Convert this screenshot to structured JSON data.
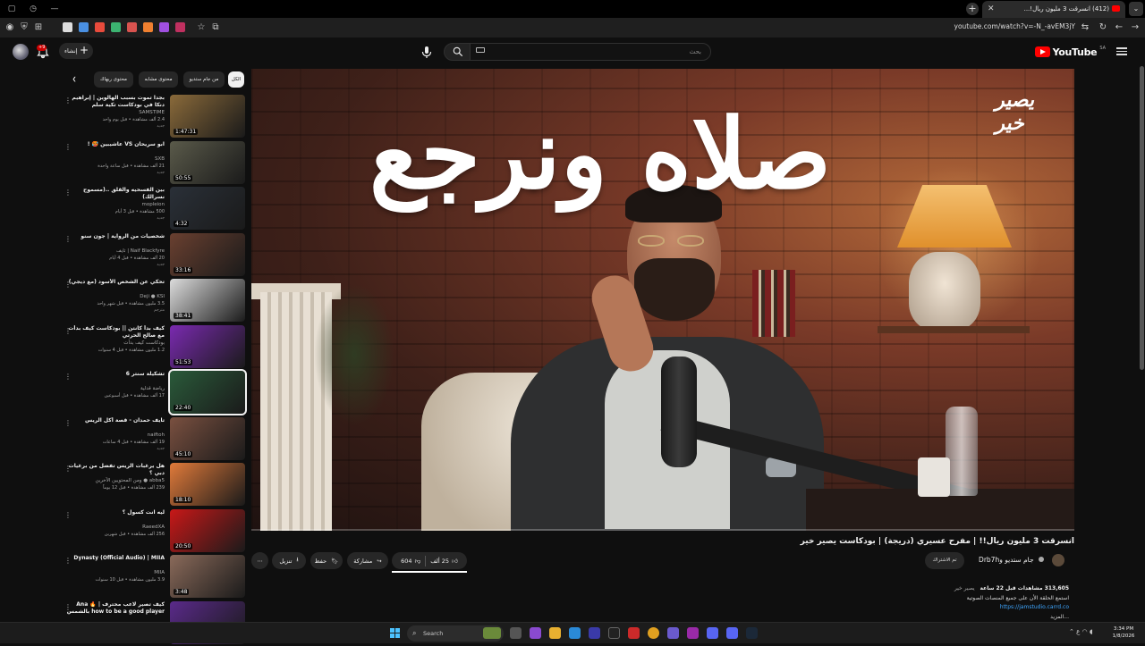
{
  "browser": {
    "active_tab_title": "(412) انسرقت 3 مليون ريال!...",
    "url": "youtube.com/watch?v=-N_-avEM3jY"
  },
  "masthead": {
    "logo_text": "YouTube",
    "logo_country": "SA",
    "search_placeholder": "بحث",
    "create_label": "إنشاء",
    "notification_count": "+9"
  },
  "player": {
    "overlay_text": "صلاه ونرجع",
    "watermark": "يصير خير"
  },
  "video": {
    "title": "انسرقت 3 مليون ريال!! | مفرح عسيري (دريجة) | بودكاست يصير خير",
    "channel_name": "جام ستديو وDrb7h",
    "subscribed_label": "تم الاشتراك",
    "likes": "25 ألف",
    "dislikes": "604",
    "share_label": "مشاركة",
    "save_label": "حفظ",
    "download_label": "تنزيل"
  },
  "description": {
    "stats": "313,605 مشاهدات  قبل 22 ساعة",
    "tag": "يصير خير",
    "line1": "استمع الحلقة الأن على جميع المنصات الصوتية",
    "link": "https://jamstudio.carrd.co",
    "more": "...المزيد"
  },
  "chips": {
    "all": "الكل",
    "from_channel": "من جام ستديو",
    "related": "محتوى مشابه",
    "watched": "محتوى ربهاك"
  },
  "recommendations": [
    {
      "title": "بجدا تموت بسبب الهالوين | إبراهيم دنكا في بودكاست تكية سلم",
      "channel": "SAMSTIME",
      "meta": "2.4 ألف مشاهدة • قبل يوم واحد",
      "badge": "جديد",
      "duration": "1:47:31",
      "thumb": "#8a6a3a"
    },
    {
      "title": "ابو سريحان VS عاشيبين 🥵 !",
      "channel": "SXB",
      "meta": "21 ألف مشاهدة • قبل ساعة واحدة",
      "badge": "جديد",
      "duration": "50:55",
      "thumb": "#5a5a4a"
    },
    {
      "title": "بين الفسحيه والقلق ..(مسموح نسرالك)",
      "channel": "mopleion",
      "meta": "500 مشاهدة • قبل 3 أيام",
      "badge": "جديد",
      "duration": "4:32",
      "thumb": "#2a3038"
    },
    {
      "title": "شخصيات من الرواية | جون سنو",
      "channel": "Naif Blackfyre | تايف",
      "meta": "20 ألف مشاهدة • قبل 4 أيام",
      "badge": "جديد",
      "duration": "33:16",
      "thumb": "#6a4030"
    },
    {
      "title": "تحكي عن الشخص الأسود (مع ديجي)",
      "channel": "Deji ● KSI",
      "meta": "3.5 مليون مشاهدة • قبل شهر واحد",
      "badge": "مترجم",
      "duration": "38:41",
      "thumb": "#dcdcdc"
    },
    {
      "title": "كيف بدأ كانتن || بودكاست كيف بدأت مع صالح الحرتي",
      "channel": "بودكاست كيف بدأت",
      "meta": "1.2 مليون مشاهدة • قبل 4 سنوات",
      "badge": "",
      "duration": "51:53",
      "thumb": "#7a2ab0"
    },
    {
      "title": "تشكيلة سنتر 6",
      "channel": "رياضة قدلية",
      "meta": "17 ألف مشاهدة • قبل أسبوعين",
      "badge": "",
      "duration": "22:40",
      "thumb": "#2a5a3a"
    },
    {
      "title": "تايف حمدان - قصة أكل الريس",
      "channel": "naiftoh",
      "meta": "19 ألف مشاهدة • قبل 4 ساعات",
      "badge": "جديد",
      "duration": "45:10",
      "thumb": "#7a5040"
    },
    {
      "title": "هل يرغبات الريس تفضل من برغيات دبي ؟",
      "channel": "abba5 ● ومن المحتويين الآخرين",
      "meta": "239 ألف مشاهدة • قبل 12 يوماً",
      "badge": "",
      "duration": "18:10",
      "thumb": "#e07a3a"
    },
    {
      "title": "ليه انت كسول ؟",
      "channel": "RaeedXA",
      "meta": "256 ألف مشاهدة • قبل شهرين",
      "badge": "",
      "duration": "20:50",
      "thumb": "#c81818"
    },
    {
      "title": "Dynasty (Official Audio) | MIIA",
      "channel": "MIIA",
      "meta": "3.9 مليون مشاهدة • قبل 10 سنوات",
      "badge": "",
      "duration": "3:48",
      "thumb": "#8a6a5a"
    },
    {
      "title": "كيف تصير لاعب محترف Ana 🔥 | how to be a good player بالشمس",
      "channel": "",
      "meta": "",
      "badge": "",
      "duration": "",
      "thumb": "#5a2a8a"
    }
  ],
  "taskbar": {
    "search_placeholder": "Search",
    "time": "3:34 PM",
    "date": "1/8/2026",
    "lang": "ع"
  },
  "colors": {
    "background": "#0f0f0f",
    "yt_red": "#ff0000",
    "link_blue": "#3ea6ff"
  }
}
